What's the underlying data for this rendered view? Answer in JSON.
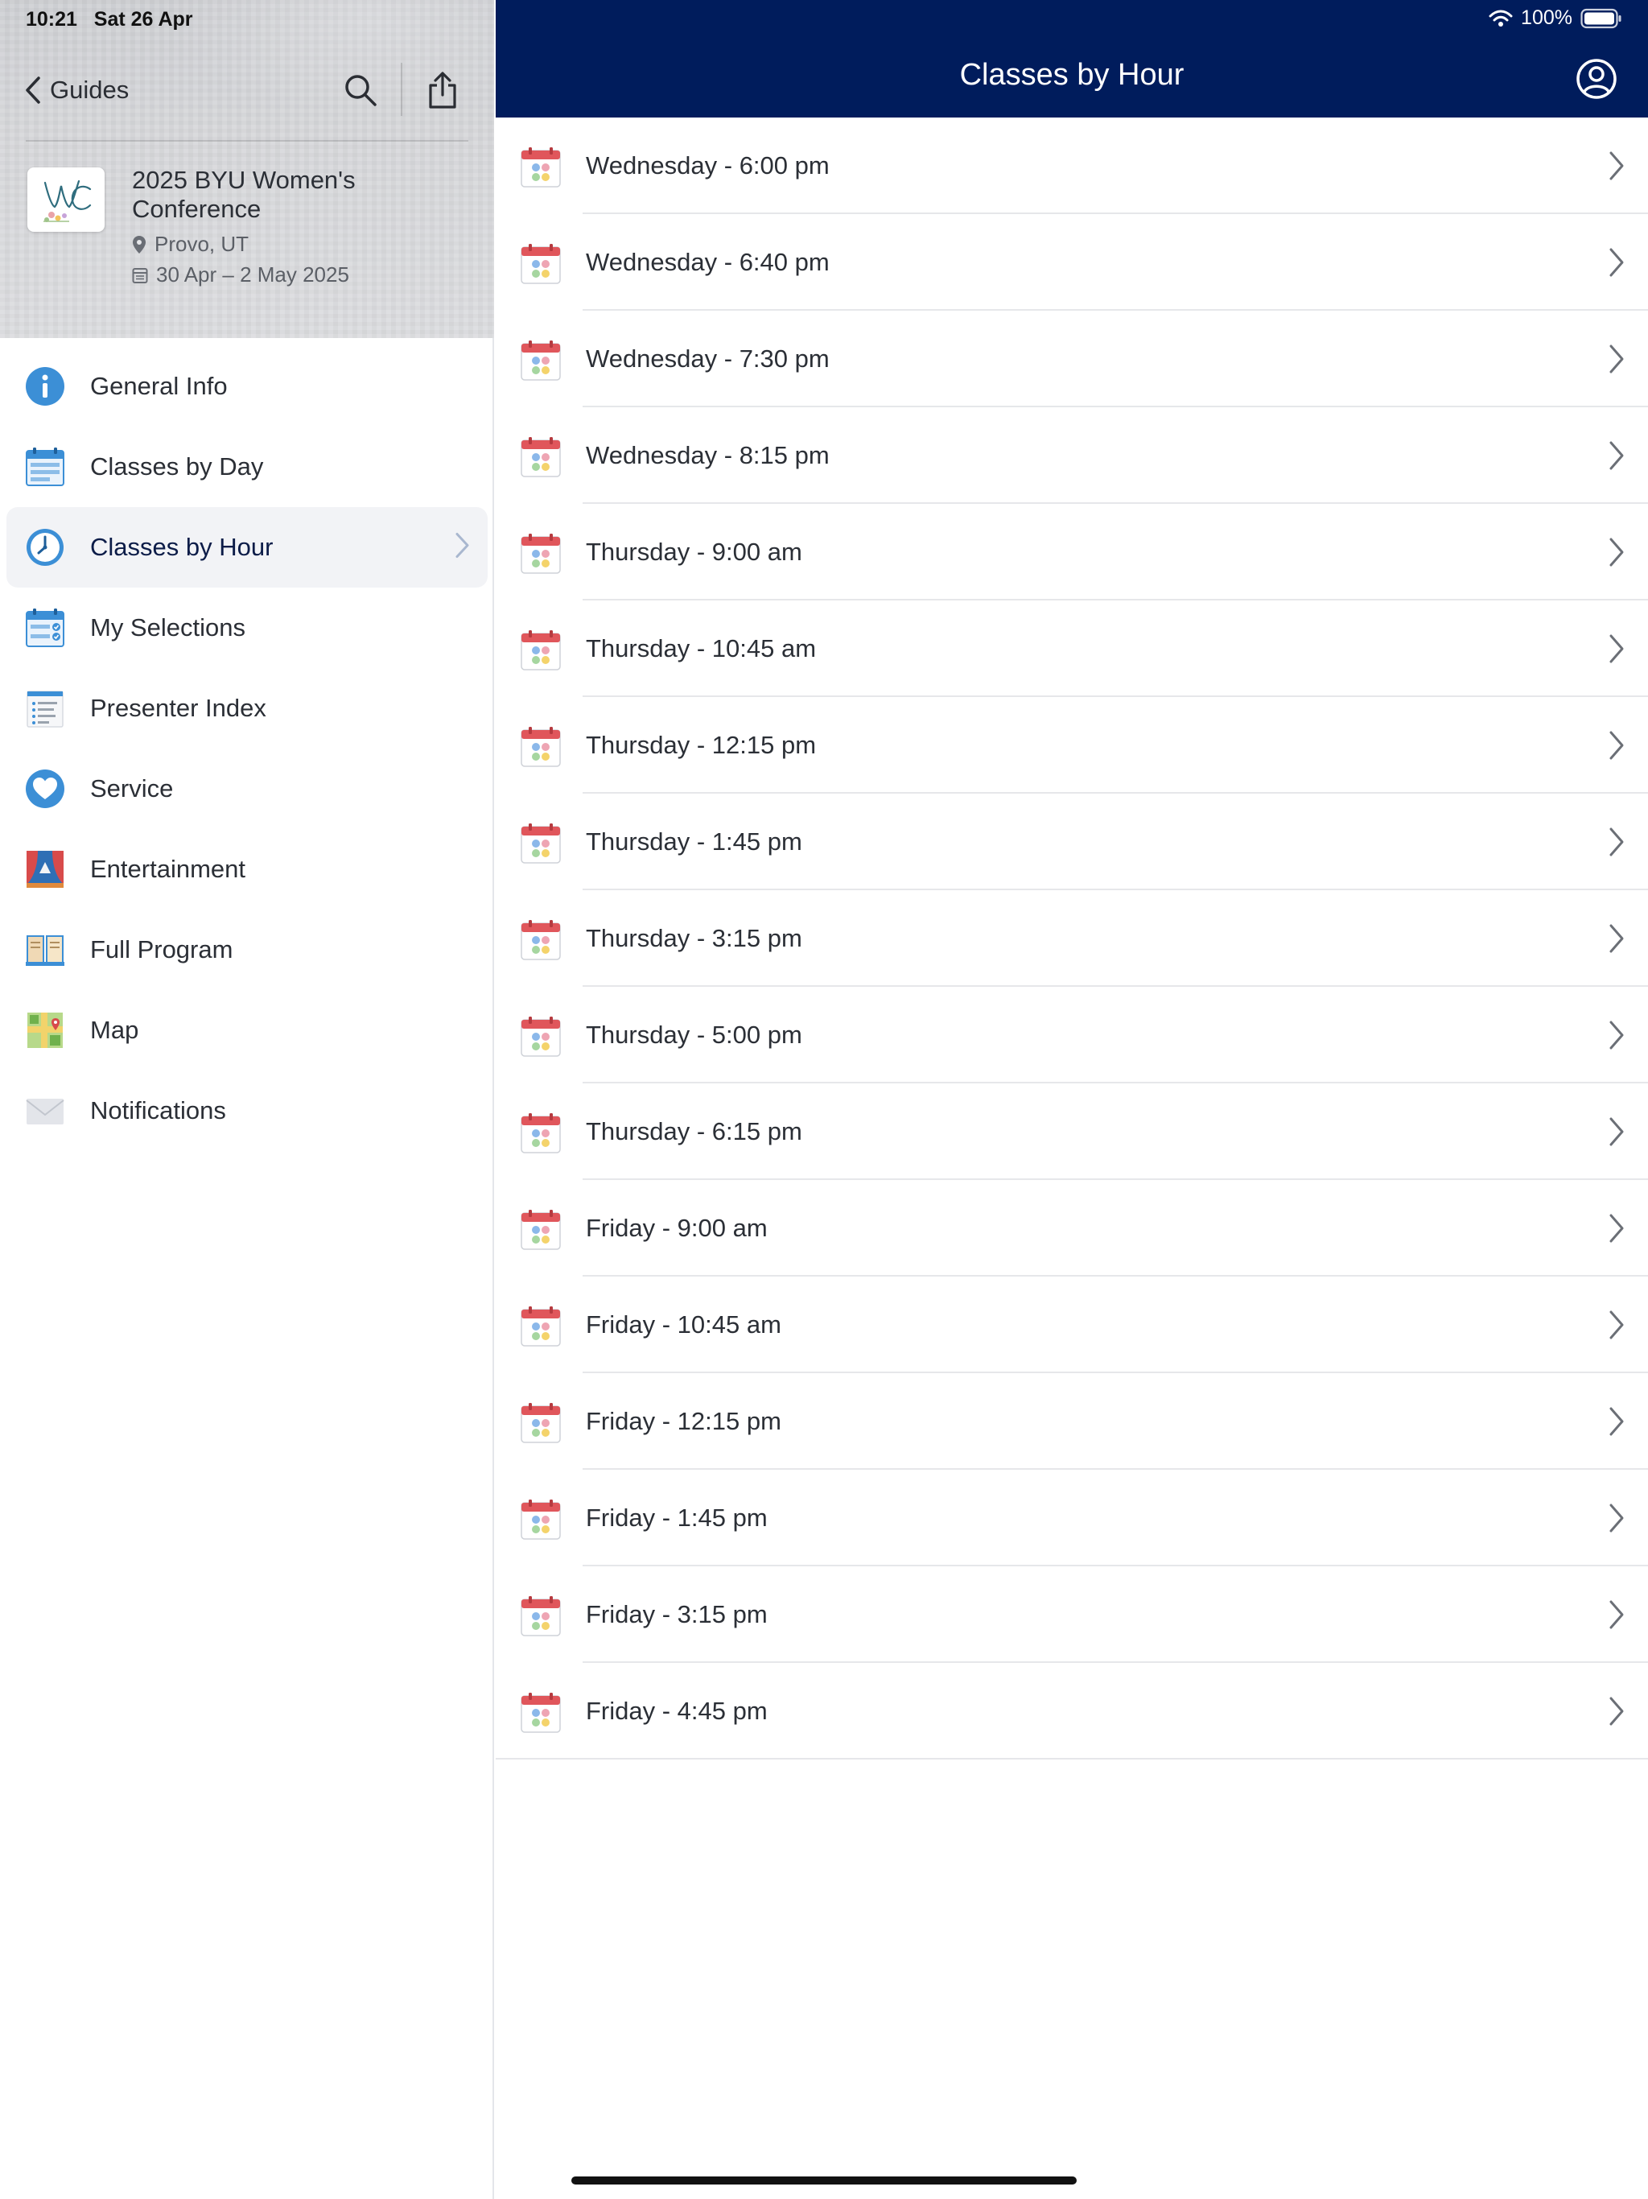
{
  "status": {
    "time": "10:21",
    "date": "Sat 26 Apr",
    "battery": "100%"
  },
  "sidebar": {
    "back_label": "Guides",
    "guide": {
      "title": "2025 BYU Women's Conference",
      "location": "Provo, UT",
      "dates": "30 Apr – 2 May 2025"
    },
    "items": [
      {
        "label": "General Info",
        "icon": "info-icon"
      },
      {
        "label": "Classes by Day",
        "icon": "calendar-icon"
      },
      {
        "label": "Classes by Hour",
        "icon": "clock-icon",
        "active": true
      },
      {
        "label": "My Selections",
        "icon": "checklist-calendar-icon"
      },
      {
        "label": "Presenter Index",
        "icon": "list-document-icon"
      },
      {
        "label": "Service",
        "icon": "heart-icon"
      },
      {
        "label": "Entertainment",
        "icon": "theater-icon"
      },
      {
        "label": "Full Program",
        "icon": "book-icon"
      },
      {
        "label": "Map",
        "icon": "map-icon"
      },
      {
        "label": "Notifications",
        "icon": "envelope-icon"
      }
    ]
  },
  "main": {
    "title": "Classes by Hour",
    "rows": [
      "Wednesday - 6:00 pm",
      "Wednesday - 6:40 pm",
      "Wednesday - 7:30 pm",
      "Wednesday - 8:15 pm",
      "Thursday - 9:00 am",
      "Thursday - 10:45 am",
      "Thursday - 12:15 pm",
      "Thursday - 1:45 pm",
      "Thursday - 3:15 pm",
      "Thursday - 5:00 pm",
      "Thursday - 6:15 pm",
      "Friday - 9:00 am",
      "Friday - 10:45 am",
      "Friday - 12:15 pm",
      "Friday - 1:45 pm",
      "Friday - 3:15 pm",
      "Friday - 4:45 pm"
    ]
  },
  "colors": {
    "header_bg": "#001c5c",
    "accent_blue": "#3c8fd6",
    "calendar_red": "#e0565b"
  }
}
